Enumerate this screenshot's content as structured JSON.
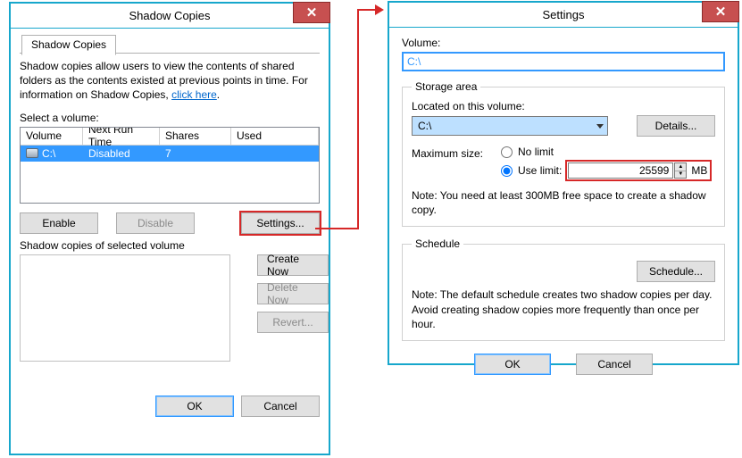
{
  "win1": {
    "title": "Shadow Copies",
    "tab_label": "Shadow Copies",
    "intro_pre": "Shadow copies allow users to view the contents of shared folders as the contents existed at previous points in time. For information on Shadow Copies, ",
    "intro_link": "click here",
    "intro_post": ".",
    "select_label": "Select a volume:",
    "headers": {
      "vol": "Volume",
      "nrt": "Next Run Time",
      "shares": "Shares",
      "used": "Used"
    },
    "row": {
      "vol": "C:\\",
      "nrt": "Disabled",
      "shares": "7",
      "used": ""
    },
    "buttons": {
      "enable": "Enable",
      "disable": "Disable",
      "settings": "Settings..."
    },
    "copies_label": "Shadow copies of selected volume",
    "side": {
      "create": "Create Now",
      "delete": "Delete Now",
      "revert": "Revert..."
    },
    "ok": "OK",
    "cancel": "Cancel"
  },
  "win2": {
    "title": "Settings",
    "volume_label": "Volume:",
    "volume_value": "C:\\",
    "group1": {
      "legend": "Storage area",
      "located_label": "Located on this volume:",
      "combo_value": "C:\\",
      "details_btn": "Details...",
      "max_label": "Maximum size:",
      "no_limit": "No limit",
      "use_limit": "Use limit:",
      "limit_value": "25599",
      "limit_unit": "MB",
      "note": "Note: You need at least 300MB free space to create a shadow copy."
    },
    "group2": {
      "legend": "Schedule",
      "schedule_btn": "Schedule...",
      "note": "Note: The default schedule creates two shadow copies per day. Avoid creating shadow copies more frequently than once per hour."
    },
    "ok": "OK",
    "cancel": "Cancel"
  }
}
